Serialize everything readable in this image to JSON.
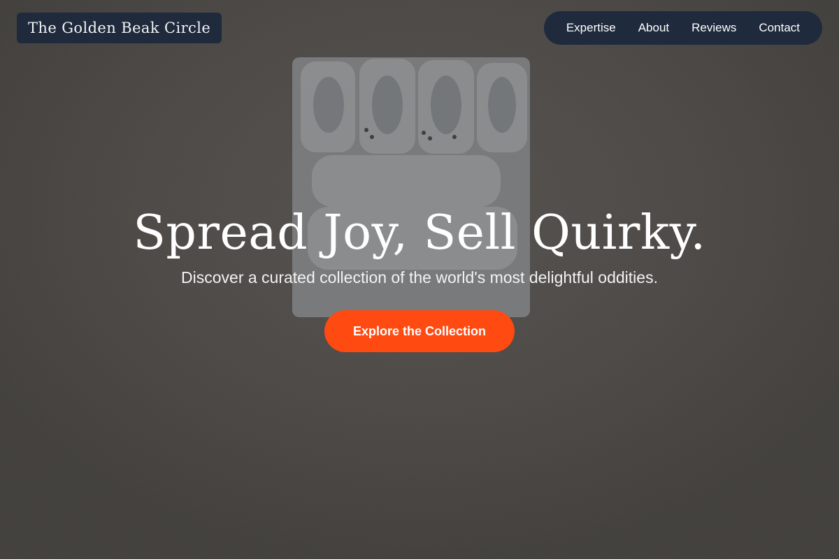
{
  "brand": {
    "name": "The Golden Beak Circle"
  },
  "nav": {
    "items": [
      {
        "label": "Expertise"
      },
      {
        "label": "About"
      },
      {
        "label": "Reviews"
      },
      {
        "label": "Contact"
      }
    ]
  },
  "hero": {
    "title": "Spread Joy, Sell Quirky.",
    "subtitle": "Discover a curated collection of the world's most delightful oddities.",
    "cta_label": "Explore the Collection"
  },
  "colors": {
    "accent": "#ff4a12",
    "nav_bg": "#1f2a3d",
    "text": "#ffffff"
  }
}
